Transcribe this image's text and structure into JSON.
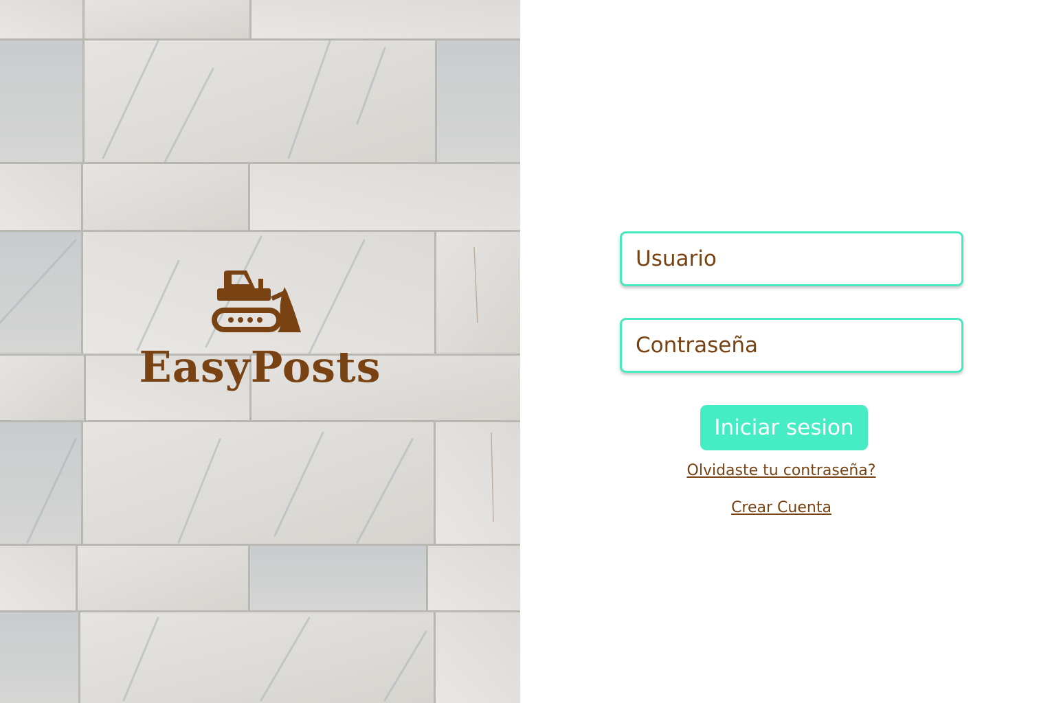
{
  "brand": {
    "name": "EasyPosts",
    "logo_icon": "bulldozer-icon",
    "color": "#784212"
  },
  "login": {
    "username_placeholder": "Usuario",
    "password_placeholder": "Contraseña",
    "username_value": "",
    "password_value": "",
    "submit_label": "Iniciar sesion",
    "forgot_link": "Olvidaste tu contraseña?",
    "create_account_link": "Crear Cuenta"
  },
  "colors": {
    "accent": "#46ecc4",
    "text": "#784212",
    "background": "#ffffff"
  }
}
